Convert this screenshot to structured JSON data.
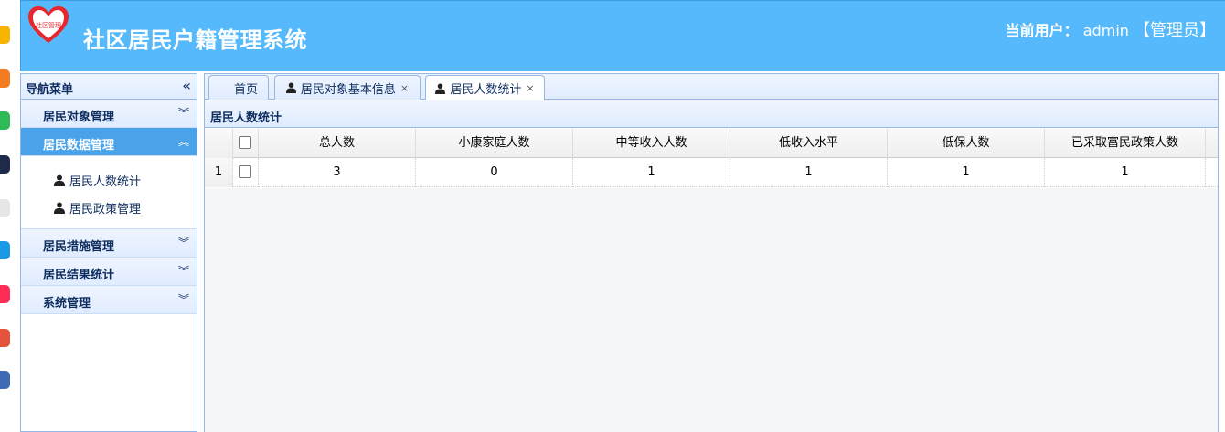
{
  "header": {
    "logo_text": "社区管理",
    "title": "社区居民户籍管理系统",
    "user_label": "当前用户：",
    "user_name": "admin",
    "user_role": "【管理员】"
  },
  "sidebar": {
    "title": "导航菜单",
    "collapse_glyph": "«",
    "groups": [
      {
        "label": "居民对象管理",
        "toggle": "︾"
      },
      {
        "label": "居民数据管理",
        "toggle": "︽",
        "items": [
          {
            "label": "居民人数统计"
          },
          {
            "label": "居民政策管理"
          }
        ]
      },
      {
        "label": "居民措施管理",
        "toggle": "︾"
      },
      {
        "label": "居民结果统计",
        "toggle": "︾"
      },
      {
        "label": "系统管理",
        "toggle": "︾"
      }
    ]
  },
  "tabs": [
    {
      "label": "首页"
    },
    {
      "label": "居民对象基本信息",
      "close": "×"
    },
    {
      "label": "居民人数统计",
      "close": "×"
    }
  ],
  "panel": {
    "title": "居民人数统计"
  },
  "table": {
    "columns": [
      "总人数",
      "小康家庭人数",
      "中等收入人数",
      "低收入水平",
      "低保人数",
      "已采取富民政策人数"
    ],
    "rows": [
      {
        "row_num": "1",
        "cells": [
          "3",
          "0",
          "1",
          "1",
          "1",
          "1"
        ]
      }
    ]
  },
  "colors": {
    "header_bg": "#55b9fb",
    "active_group": "#4aa3e8",
    "border": "#95b8e7"
  }
}
